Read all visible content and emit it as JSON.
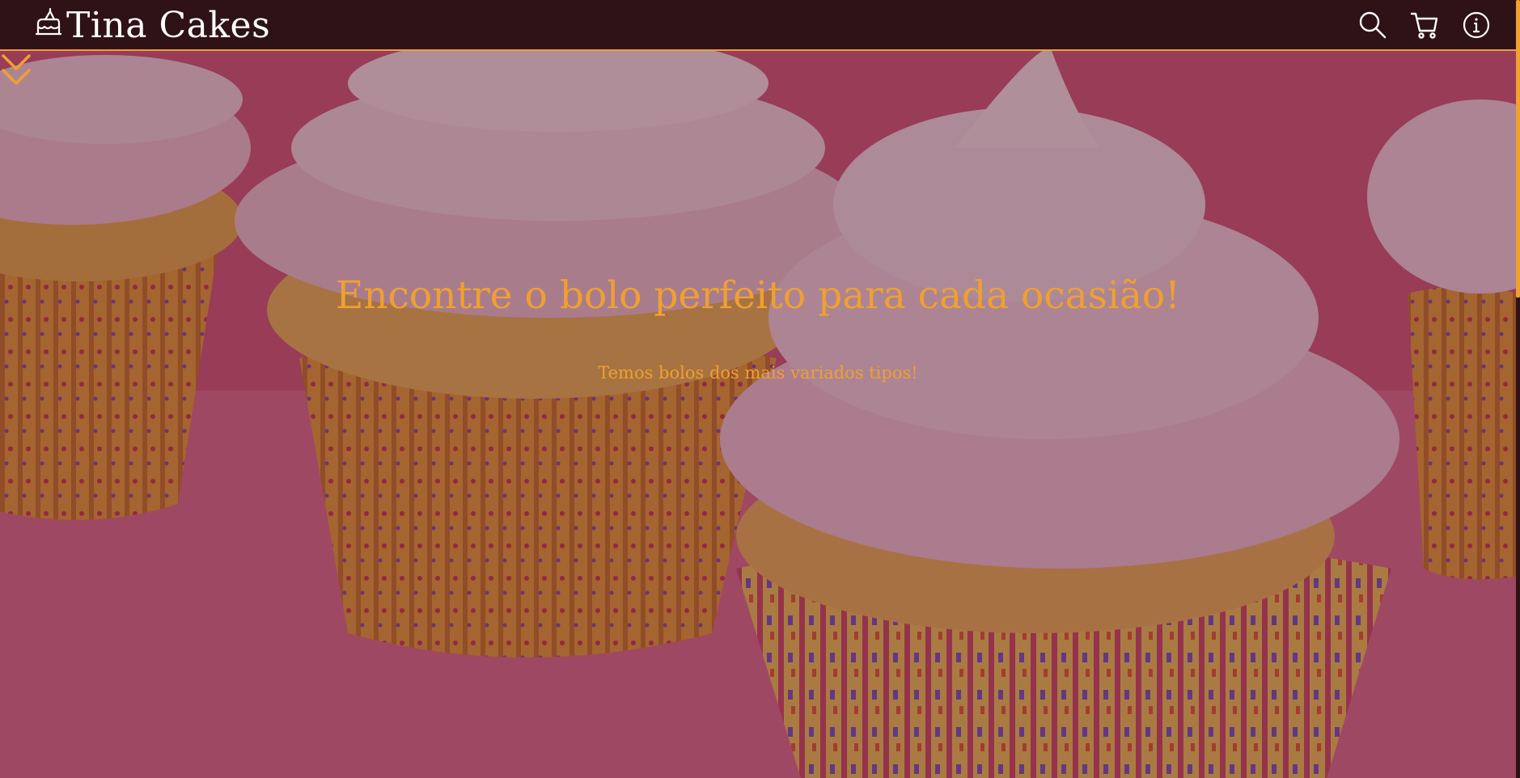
{
  "brand": {
    "name": "Tina Cakes",
    "icon": "cake-icon"
  },
  "nav": {
    "icons": [
      "search-icon",
      "cart-icon",
      "info-icon"
    ]
  },
  "hero": {
    "headline": "Encontre o bolo perfeito para cada ocasião!",
    "subline": "Temos bolos dos mais variados tipos!",
    "scroll_icon": "double-chevron-down-icon"
  },
  "colors": {
    "navbar_bg": "#2e1216",
    "accent": "#f0a030",
    "brand_text": "#ffffff",
    "hero_bg": "#d7577a"
  }
}
